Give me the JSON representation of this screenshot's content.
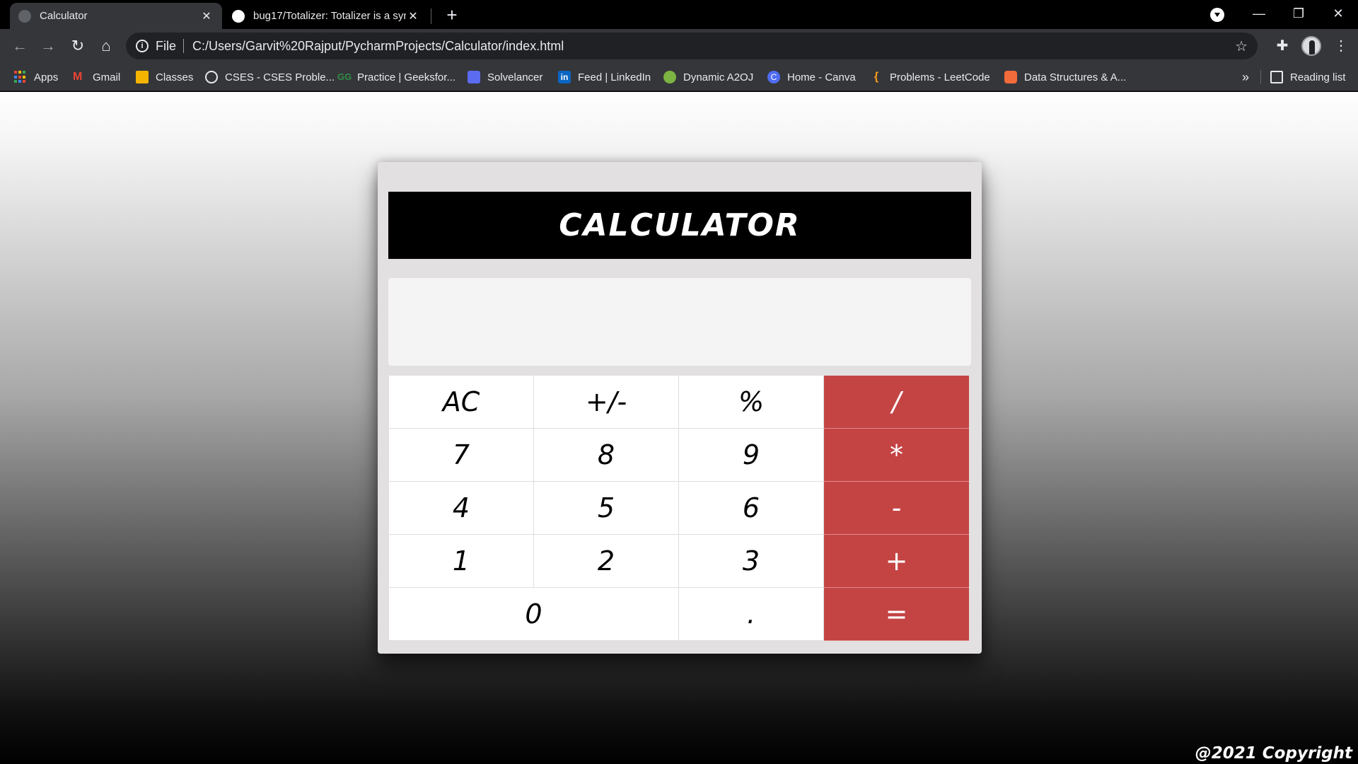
{
  "browser": {
    "tabs": [
      {
        "title": "Calculator",
        "active": true
      },
      {
        "title": "bug17/Totalizer: Totalizer is a syn",
        "active": false
      }
    ],
    "address": {
      "scheme": "File",
      "url": "C:/Users/Garvit%20Rajput/PycharmProjects/Calculator/index.html"
    },
    "bookmarks": [
      {
        "label": "Apps",
        "icon": "apps-grid-icon"
      },
      {
        "label": "Gmail",
        "icon": "gmail-icon",
        "color": "#ea4335"
      },
      {
        "label": "Classes",
        "icon": "classroom-icon",
        "color": "#f4b400"
      },
      {
        "label": "CSES - CSES Proble...",
        "icon": "globe-icon",
        "color": "#e8eaed"
      },
      {
        "label": "Practice | Geeksfor...",
        "icon": "gfg-icon",
        "color": "#2f8d46"
      },
      {
        "label": "Solvelancer",
        "icon": "solvelancer-icon",
        "color": "#5b6cf0"
      },
      {
        "label": "Feed | LinkedIn",
        "icon": "linkedin-icon",
        "color": "#0a66c2"
      },
      {
        "label": "Dynamic A2OJ",
        "icon": "a2oj-icon",
        "color": "#7cb342"
      },
      {
        "label": "Home - Canva",
        "icon": "canva-icon",
        "color": "#4f6cf2"
      },
      {
        "label": "Problems - LeetCode",
        "icon": "leetcode-icon",
        "color": "#ffa116"
      },
      {
        "label": "Data Structures & A...",
        "icon": "codingninjas-icon",
        "color": "#f26b3a"
      }
    ],
    "more_bookmarks": "»",
    "reading_list": "Reading list"
  },
  "calculator": {
    "title": "CALCULATOR",
    "display": "",
    "keys": [
      {
        "label": "AC",
        "type": "func"
      },
      {
        "label": "+/-",
        "type": "func"
      },
      {
        "label": "%",
        "type": "func"
      },
      {
        "label": "/",
        "type": "op"
      },
      {
        "label": "7",
        "type": "num"
      },
      {
        "label": "8",
        "type": "num"
      },
      {
        "label": "9",
        "type": "num"
      },
      {
        "label": "*",
        "type": "op"
      },
      {
        "label": "4",
        "type": "num"
      },
      {
        "label": "5",
        "type": "num"
      },
      {
        "label": "6",
        "type": "num"
      },
      {
        "label": "-",
        "type": "op"
      },
      {
        "label": "1",
        "type": "num"
      },
      {
        "label": "2",
        "type": "num"
      },
      {
        "label": "3",
        "type": "num"
      },
      {
        "label": "+",
        "type": "op"
      },
      {
        "label": "0",
        "type": "num",
        "wide": true
      },
      {
        "label": ".",
        "type": "num"
      },
      {
        "label": "=",
        "type": "op"
      }
    ],
    "accent_color": "#c44444"
  },
  "footer": {
    "copyright": "@2021 Copyright"
  }
}
